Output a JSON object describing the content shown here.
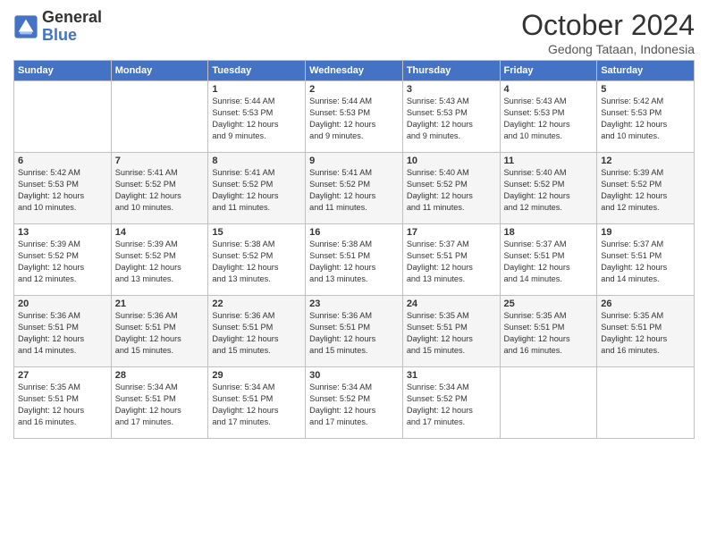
{
  "logo": {
    "line1": "General",
    "line2": "Blue"
  },
  "title": "October 2024",
  "subtitle": "Gedong Tataan, Indonesia",
  "headers": [
    "Sunday",
    "Monday",
    "Tuesday",
    "Wednesday",
    "Thursday",
    "Friday",
    "Saturday"
  ],
  "weeks": [
    [
      {
        "day": "",
        "info": ""
      },
      {
        "day": "",
        "info": ""
      },
      {
        "day": "1",
        "info": "Sunrise: 5:44 AM\nSunset: 5:53 PM\nDaylight: 12 hours\nand 9 minutes."
      },
      {
        "day": "2",
        "info": "Sunrise: 5:44 AM\nSunset: 5:53 PM\nDaylight: 12 hours\nand 9 minutes."
      },
      {
        "day": "3",
        "info": "Sunrise: 5:43 AM\nSunset: 5:53 PM\nDaylight: 12 hours\nand 9 minutes."
      },
      {
        "day": "4",
        "info": "Sunrise: 5:43 AM\nSunset: 5:53 PM\nDaylight: 12 hours\nand 10 minutes."
      },
      {
        "day": "5",
        "info": "Sunrise: 5:42 AM\nSunset: 5:53 PM\nDaylight: 12 hours\nand 10 minutes."
      }
    ],
    [
      {
        "day": "6",
        "info": "Sunrise: 5:42 AM\nSunset: 5:53 PM\nDaylight: 12 hours\nand 10 minutes."
      },
      {
        "day": "7",
        "info": "Sunrise: 5:41 AM\nSunset: 5:52 PM\nDaylight: 12 hours\nand 10 minutes."
      },
      {
        "day": "8",
        "info": "Sunrise: 5:41 AM\nSunset: 5:52 PM\nDaylight: 12 hours\nand 11 minutes."
      },
      {
        "day": "9",
        "info": "Sunrise: 5:41 AM\nSunset: 5:52 PM\nDaylight: 12 hours\nand 11 minutes."
      },
      {
        "day": "10",
        "info": "Sunrise: 5:40 AM\nSunset: 5:52 PM\nDaylight: 12 hours\nand 11 minutes."
      },
      {
        "day": "11",
        "info": "Sunrise: 5:40 AM\nSunset: 5:52 PM\nDaylight: 12 hours\nand 12 minutes."
      },
      {
        "day": "12",
        "info": "Sunrise: 5:39 AM\nSunset: 5:52 PM\nDaylight: 12 hours\nand 12 minutes."
      }
    ],
    [
      {
        "day": "13",
        "info": "Sunrise: 5:39 AM\nSunset: 5:52 PM\nDaylight: 12 hours\nand 12 minutes."
      },
      {
        "day": "14",
        "info": "Sunrise: 5:39 AM\nSunset: 5:52 PM\nDaylight: 12 hours\nand 13 minutes."
      },
      {
        "day": "15",
        "info": "Sunrise: 5:38 AM\nSunset: 5:52 PM\nDaylight: 12 hours\nand 13 minutes."
      },
      {
        "day": "16",
        "info": "Sunrise: 5:38 AM\nSunset: 5:51 PM\nDaylight: 12 hours\nand 13 minutes."
      },
      {
        "day": "17",
        "info": "Sunrise: 5:37 AM\nSunset: 5:51 PM\nDaylight: 12 hours\nand 13 minutes."
      },
      {
        "day": "18",
        "info": "Sunrise: 5:37 AM\nSunset: 5:51 PM\nDaylight: 12 hours\nand 14 minutes."
      },
      {
        "day": "19",
        "info": "Sunrise: 5:37 AM\nSunset: 5:51 PM\nDaylight: 12 hours\nand 14 minutes."
      }
    ],
    [
      {
        "day": "20",
        "info": "Sunrise: 5:36 AM\nSunset: 5:51 PM\nDaylight: 12 hours\nand 14 minutes."
      },
      {
        "day": "21",
        "info": "Sunrise: 5:36 AM\nSunset: 5:51 PM\nDaylight: 12 hours\nand 15 minutes."
      },
      {
        "day": "22",
        "info": "Sunrise: 5:36 AM\nSunset: 5:51 PM\nDaylight: 12 hours\nand 15 minutes."
      },
      {
        "day": "23",
        "info": "Sunrise: 5:36 AM\nSunset: 5:51 PM\nDaylight: 12 hours\nand 15 minutes."
      },
      {
        "day": "24",
        "info": "Sunrise: 5:35 AM\nSunset: 5:51 PM\nDaylight: 12 hours\nand 15 minutes."
      },
      {
        "day": "25",
        "info": "Sunrise: 5:35 AM\nSunset: 5:51 PM\nDaylight: 12 hours\nand 16 minutes."
      },
      {
        "day": "26",
        "info": "Sunrise: 5:35 AM\nSunset: 5:51 PM\nDaylight: 12 hours\nand 16 minutes."
      }
    ],
    [
      {
        "day": "27",
        "info": "Sunrise: 5:35 AM\nSunset: 5:51 PM\nDaylight: 12 hours\nand 16 minutes."
      },
      {
        "day": "28",
        "info": "Sunrise: 5:34 AM\nSunset: 5:51 PM\nDaylight: 12 hours\nand 17 minutes."
      },
      {
        "day": "29",
        "info": "Sunrise: 5:34 AM\nSunset: 5:51 PM\nDaylight: 12 hours\nand 17 minutes."
      },
      {
        "day": "30",
        "info": "Sunrise: 5:34 AM\nSunset: 5:52 PM\nDaylight: 12 hours\nand 17 minutes."
      },
      {
        "day": "31",
        "info": "Sunrise: 5:34 AM\nSunset: 5:52 PM\nDaylight: 12 hours\nand 17 minutes."
      },
      {
        "day": "",
        "info": ""
      },
      {
        "day": "",
        "info": ""
      }
    ]
  ]
}
